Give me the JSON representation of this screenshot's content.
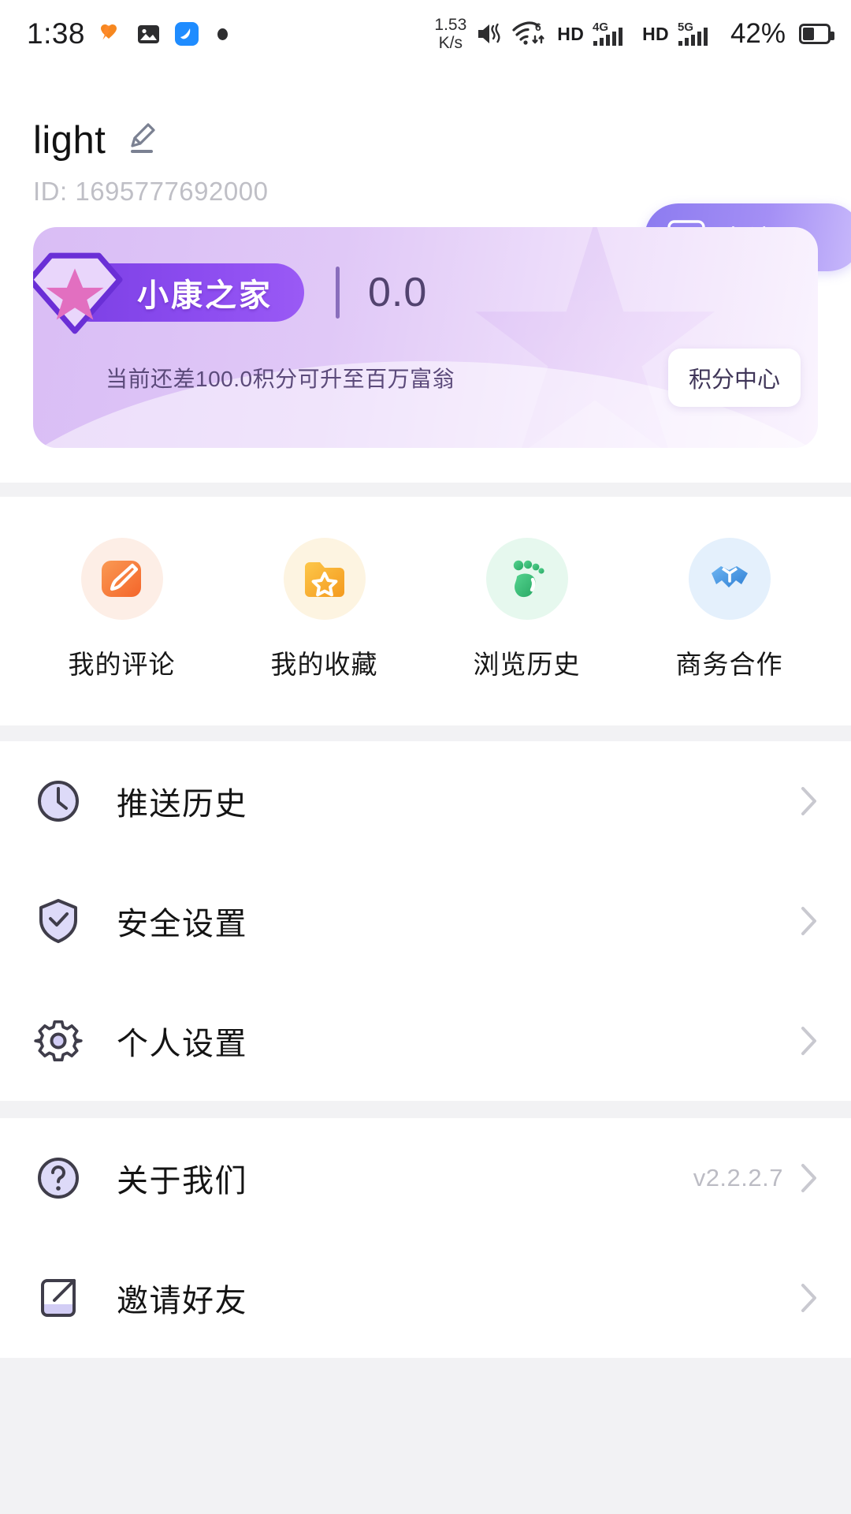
{
  "statusbar": {
    "clock": "1:38",
    "icons": [
      "heart-icon",
      "gallery-icon",
      "app-blue-icon",
      "dot-indicator"
    ],
    "net_speed_value": "1.53",
    "net_speed_unit": "K/s",
    "mute_icon": "mute-vibrate-icon",
    "wifi_icon": "wifi-6-icon",
    "wifi_generation": "6",
    "hd_label_1": "HD",
    "network_type": "4G",
    "signal_icon": "signal-bars-icon",
    "hd_label_2": "HD",
    "network_type_2": "5G",
    "signal_icon_2": "signal-bars-icon",
    "battery_percent": "42%"
  },
  "profile": {
    "username": "light",
    "edit_icon": "pencil-edit-icon",
    "user_id": "ID: 1695777692000",
    "verify_button": {
      "label": "去认证",
      "icon": "id-card-icon"
    }
  },
  "member_card": {
    "level_badge": "小康之家",
    "badge_icon": "diamond-star-icon",
    "score": "0.0",
    "hint": "当前还差100.0积分可升至百万富翁",
    "points_button": "积分中心"
  },
  "quick_actions": [
    {
      "label": "我的评论",
      "icon": "comment-pencil-icon",
      "color": "#f4793c",
      "bg": "#fdeee6"
    },
    {
      "label": "我的收藏",
      "icon": "folder-star-icon",
      "color": "#f8ae2b",
      "bg": "#fdf4e1"
    },
    {
      "label": "浏览历史",
      "icon": "footprint-icon",
      "color": "#3fc07d",
      "bg": "#e6f8ee"
    },
    {
      "label": "商务合作",
      "icon": "handshake-icon",
      "color": "#4a9ae8",
      "bg": "#e4f0fc"
    }
  ],
  "menu_primary": [
    {
      "label": "推送历史",
      "icon": "clock-icon",
      "value": "",
      "chevron": "chevron-right-icon"
    },
    {
      "label": "安全设置",
      "icon": "shield-check-icon",
      "value": "",
      "chevron": "chevron-right-icon"
    },
    {
      "label": "个人设置",
      "icon": "gear-icon",
      "value": "",
      "chevron": "chevron-right-icon"
    }
  ],
  "menu_secondary": [
    {
      "label": "关于我们",
      "icon": "question-circle-icon",
      "value": "v2.2.2.7",
      "chevron": "chevron-right-icon"
    },
    {
      "label": "邀请好友",
      "icon": "share-external-icon",
      "value": "",
      "chevron": "chevron-right-icon"
    }
  ],
  "colors": {
    "accent_purple": "#8c7bf0",
    "badge_purple": "#7b3fe4",
    "card_bg": "#d9bdf5",
    "page_bg": "#f2f2f4",
    "icon_outline": "#3f3d4a",
    "icon_fill": "#d2cdf5"
  }
}
